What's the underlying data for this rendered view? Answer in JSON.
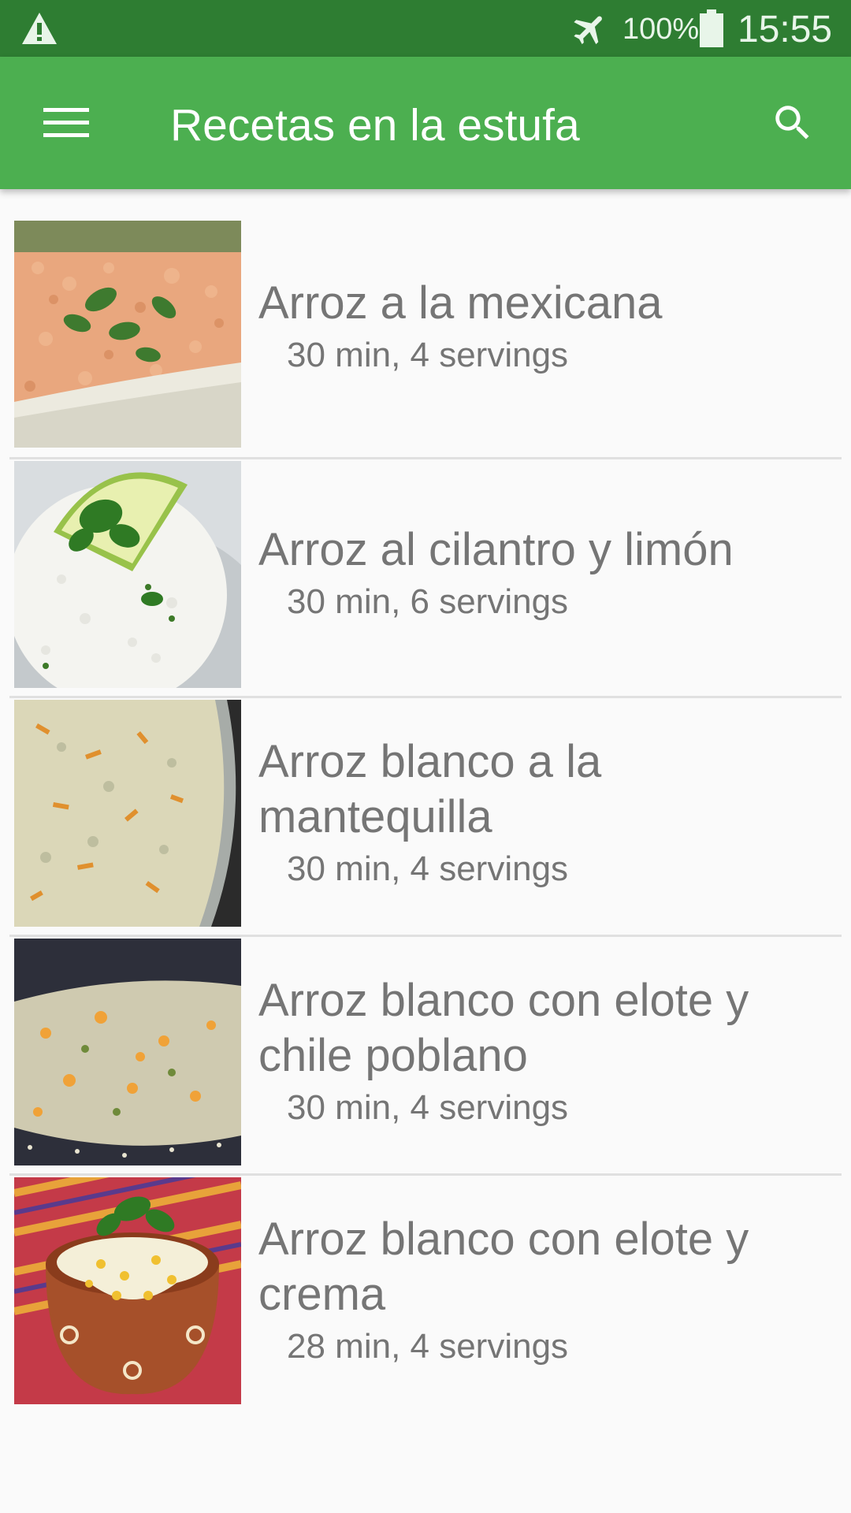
{
  "status_bar": {
    "battery_percent": "100%",
    "time": "15:55",
    "icons": [
      "warning-icon",
      "airplane-mode-icon",
      "battery-full-icon"
    ]
  },
  "app_bar": {
    "title": "Recetas en la estufa",
    "icons": [
      "menu-icon",
      "search-icon"
    ]
  },
  "recipes": [
    {
      "title": "Arroz a la mexicana",
      "meta": "30 min, 4 servings"
    },
    {
      "title": "Arroz al cilantro y limón",
      "meta": "30 min, 6 servings"
    },
    {
      "title": "Arroz blanco a la mantequilla",
      "meta": "30 min, 4 servings"
    },
    {
      "title": "Arroz blanco con elote y chile poblano",
      "meta": "30 min, 4 servings"
    },
    {
      "title": "Arroz blanco con elote y crema",
      "meta": "28 min, 4 servings"
    }
  ],
  "colors": {
    "status_bar": "#2e7d32",
    "app_bar": "#4caf50",
    "background": "#fafafa",
    "text": "#757575"
  }
}
